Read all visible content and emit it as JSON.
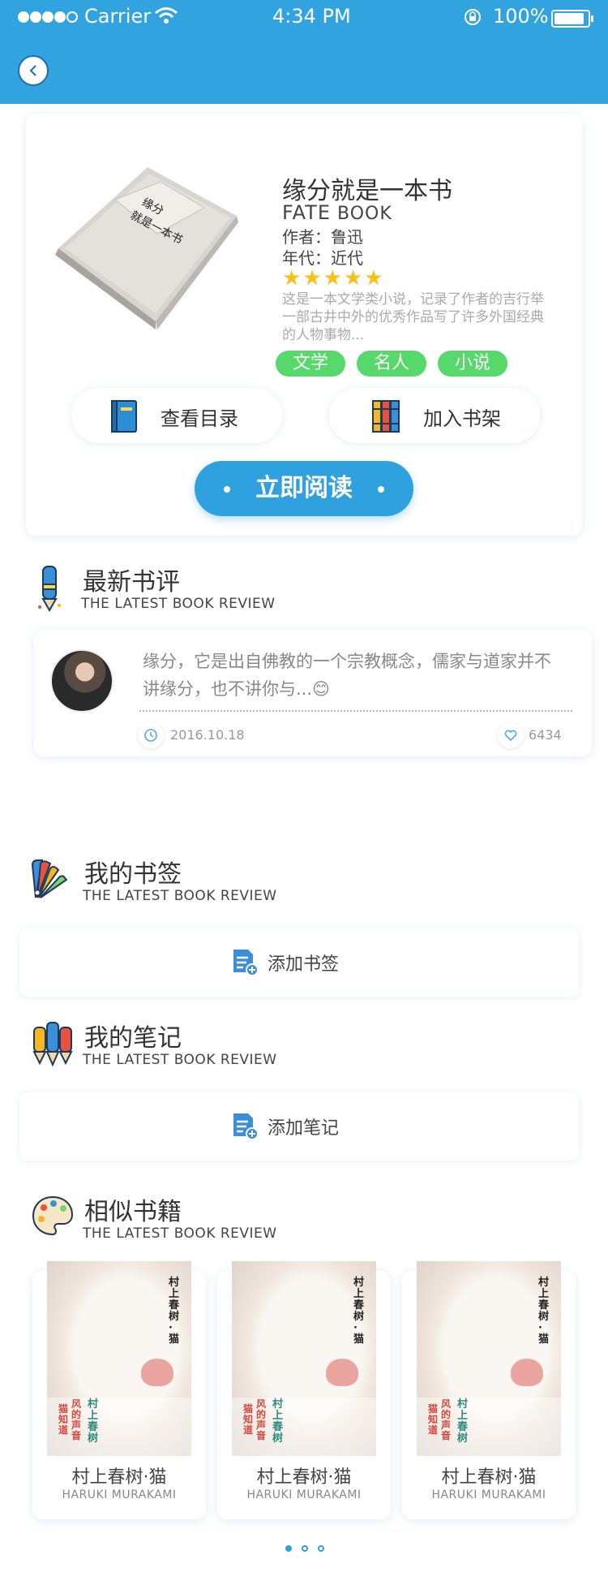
{
  "status": {
    "carrier": "Carrier",
    "time": "4:34 PM",
    "battery": "100%"
  },
  "book": {
    "title": "缘分就是一本书",
    "subtitle_big": "FATE",
    "subtitle_small": "BOOK",
    "author": "作者：鲁迅",
    "era": "年代：近代",
    "rating": 5,
    "description": "这是一本文学类小说，记录了作者的吉行举一部古井中外的优秀作品写了许多外国经典的人物事物...",
    "tags": [
      "文学",
      "名人",
      "小说"
    ],
    "catalog_label": "查看目录",
    "shelf_label": "加入书架",
    "read_label": "立即阅读",
    "cover_text": "缘分 就是一本书"
  },
  "review_section": {
    "title": "最新书评",
    "subtitle": "THE LATEST BOOK REVIEW"
  },
  "review": {
    "text": "缘分，它是出自佛教的一个宗教概念，儒家与道家并不讲缘分，也不讲你与...",
    "emoji": "😊",
    "date": "2016.10.18",
    "likes": "6434"
  },
  "bookmark_section": {
    "title": "我的书签",
    "subtitle": "THE LATEST BOOK REVIEW",
    "add_label": "添加书签"
  },
  "notes_section": {
    "title": "我的笔记",
    "subtitle": "THE LATEST BOOK REVIEW",
    "add_label": "添加笔记"
  },
  "similar_section": {
    "title": "相似书籍",
    "subtitle": "THE LATEST BOOK REVIEW"
  },
  "similar_books": [
    {
      "title": "村上春树·猫",
      "subtitle": "HARUKI MURAKAMI",
      "cover_v1": "村上春树·猫",
      "cover_v2": "村上春树",
      "cover_v3": "猫知道",
      "cover_v4": "风的声音"
    },
    {
      "title": "村上春树·猫",
      "subtitle": "HARUKI MURAKAMI",
      "cover_v1": "村上春树·猫",
      "cover_v2": "村上春树",
      "cover_v3": "猫知道",
      "cover_v4": "风的声音"
    },
    {
      "title": "村上春树·猫",
      "subtitle": "HARUKI MURAKAMI",
      "cover_v1": "村上春树·猫",
      "cover_v2": "村上春树",
      "cover_v3": "猫知道",
      "cover_v4": "风的声音"
    }
  ],
  "pagination": {
    "count": 3,
    "active": 0
  },
  "colors": {
    "header": "#31a4e0",
    "accent": "#2fa1df",
    "tag": "#57d86a",
    "star": "#f9c21b"
  }
}
